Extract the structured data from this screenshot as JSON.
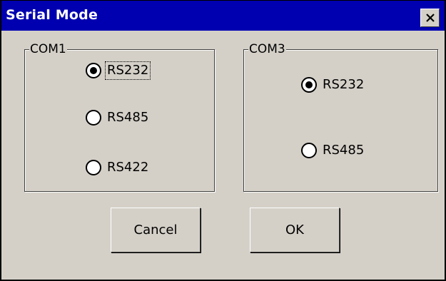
{
  "window": {
    "title": "Serial Mode",
    "close_icon": "close-icon"
  },
  "com1": {
    "label": "COM1",
    "options": [
      {
        "label": "RS232",
        "selected": true
      },
      {
        "label": "RS485",
        "selected": false
      },
      {
        "label": "RS422",
        "selected": false
      }
    ]
  },
  "com3": {
    "label": "COM3",
    "options": [
      {
        "label": "RS232",
        "selected": true
      },
      {
        "label": "RS485",
        "selected": false
      }
    ]
  },
  "buttons": {
    "cancel_label": "Cancel",
    "ok_label": "OK"
  },
  "colors": {
    "titlebar": "#0000b0",
    "face": "#d4d0c8"
  }
}
